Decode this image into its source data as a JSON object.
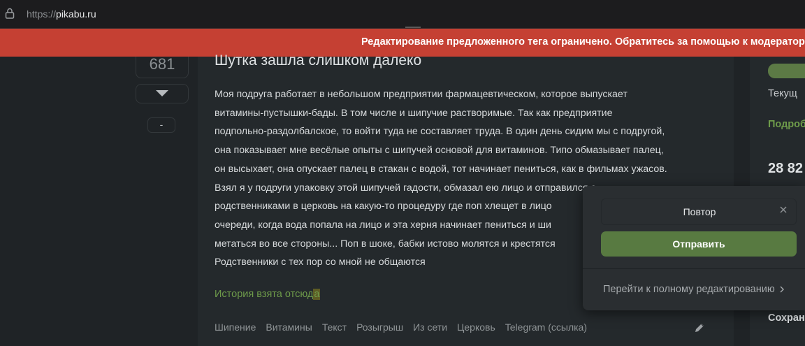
{
  "browser": {
    "url_scheme": "https://",
    "url_host": "pikabu.ru"
  },
  "banner": {
    "text": "Редактирование предложенного тега ограничено. Обратитесь за помощью к модератор"
  },
  "rating": {
    "value": "681",
    "minus_label": "-"
  },
  "story": {
    "title": "Шутка зашла слишком далеко",
    "lines": [
      "Моя подруга работает в небольшом предприятии фармацевтическом, которое выпускает",
      "витамины-пустышки-бады. В том числе и шипучие растворимые. Так как предприятие",
      "подпольно-раздолбалское, то войти туда не составляет труда. В один день сидим мы с подругой,",
      "она показывает мне весёлые опыты с шипучей основой для витаминов. Типо обмазывает палец,",
      "он высыхает, она опускает палец в стакан с водой, тот начинает пениться, как в фильмах ужасов.",
      "Взял я у подруги упаковку этой шипучей гадости, обмазал ею лицо и отправился с",
      "родственниками в церковь на какую-то процедуру где поп хлещет в лицо",
      "очереди, когда вода попала на лицо и эта херня начинает пениться и ши",
      "метаться во все стороны... Поп в шоке, бабки истово молятся и крестятся",
      "Родственники с тех пор со мной не общаются"
    ],
    "source_text": "История взята отсюд",
    "source_highlight": "а",
    "tags": [
      "Шипение",
      "Витамины",
      "Текст",
      "Розыгрыш",
      "Из сети",
      "Церковь",
      "Telegram (ссылка)"
    ]
  },
  "sidebar": {
    "current_label": "Текущ",
    "details_link": "Подроб",
    "counter": "28 82",
    "saved_label": "Сохран"
  },
  "popup": {
    "input_value": "Повтор",
    "submit_label": "Отправить",
    "full_edit_label": "Перейти к полному редактированию"
  },
  "colors": {
    "accent_green": "#587a41",
    "banner_red": "#c54033",
    "background": "#1f2326"
  }
}
